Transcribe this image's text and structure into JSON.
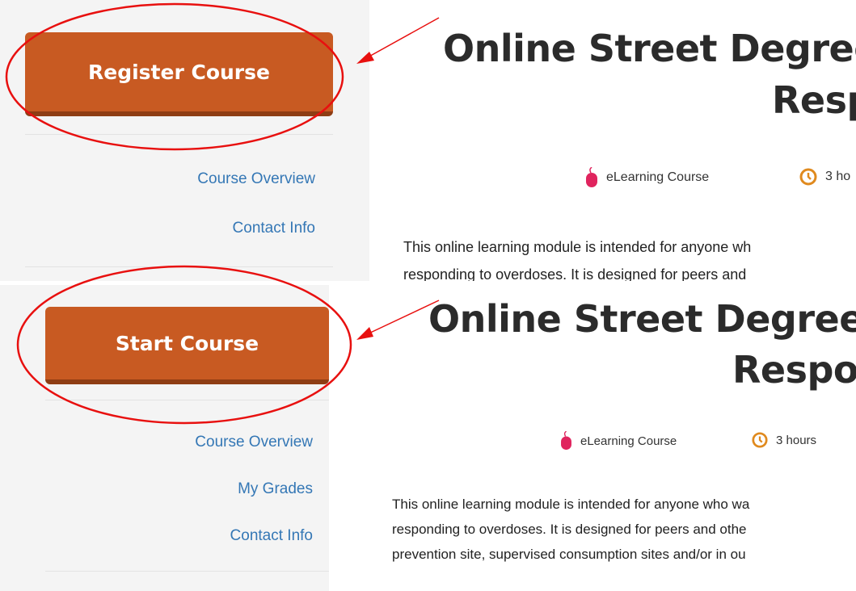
{
  "panels": [
    {
      "button_label": "Register Course",
      "nav_items": [
        "Course Overview",
        "Contact Info"
      ],
      "title_line1": "Online Street Degree",
      "title_line2": "Resp",
      "meta_type": "eLearning Course",
      "meta_duration": "3 ho",
      "body_lines": [
        "This online learning module is intended for anyone wh",
        "responding to overdoses. It is designed for peers and"
      ]
    },
    {
      "button_label": "Start Course",
      "nav_items": [
        "Course Overview",
        "My Grades",
        "Contact Info"
      ],
      "title_line1": "Online Street Degree –",
      "title_line2": "Respo",
      "meta_type": "eLearning Course",
      "meta_duration": "3 hours",
      "body_lines": [
        "This online learning module is intended for anyone who wa",
        "responding to overdoses. It is designed for peers and othe",
        "prevention site, supervised consumption sites and/or in ou"
      ]
    }
  ],
  "colors": {
    "button": "#c85a22",
    "link": "#3477b5",
    "annotation": "#e8100f",
    "mouse_icon": "#e0245e",
    "clock_icon": "#e08a1e"
  },
  "icons": {
    "type_icon": "mouse-icon",
    "duration_icon": "clock-icon"
  }
}
